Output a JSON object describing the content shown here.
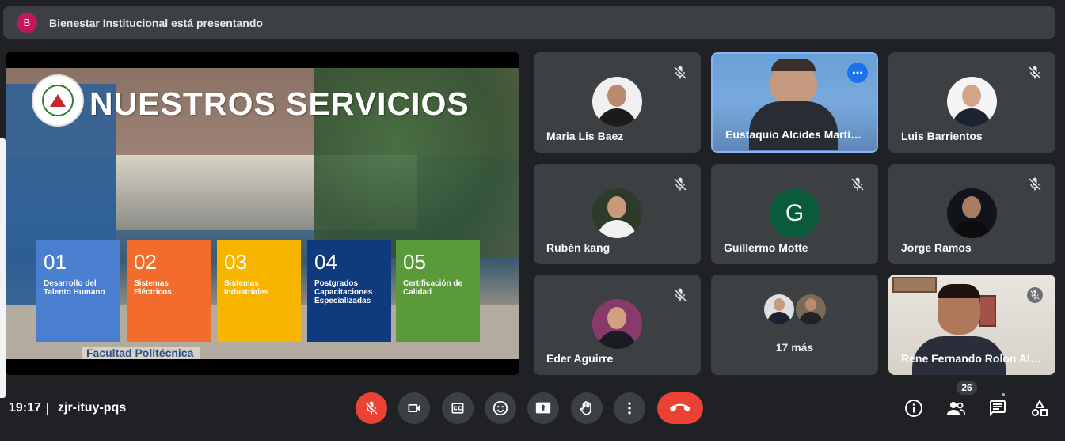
{
  "presenter_bar": {
    "avatar_letter": "B",
    "text": "Bienestar Institucional está presentando"
  },
  "slide": {
    "title": "NUESTROS SERVICIOS",
    "footer_sign": "Facultad Politécnica",
    "services": [
      {
        "num": "01",
        "label": "Desarrollo del Talento Humano",
        "color": "#4a7fd0"
      },
      {
        "num": "02",
        "label": "Sistemas Eléctricos",
        "color": "#f26d2d"
      },
      {
        "num": "03",
        "label": "Sistemas Industriales",
        "color": "#f7b500"
      },
      {
        "num": "04",
        "label": "Postgrados Capacitaciones Especializadas",
        "color": "#0f3a7d"
      },
      {
        "num": "05",
        "label": "Certificación de Calidad",
        "color": "#5a9a3a"
      }
    ]
  },
  "participants": [
    {
      "name": "Maria Lis Baez",
      "muted": true
    },
    {
      "name": "Eustaquio Alcides Martí…",
      "muted": false,
      "active": true
    },
    {
      "name": "Luis Barrientos",
      "muted": true
    },
    {
      "name": "Rubén kang",
      "muted": true
    },
    {
      "name": "Guillermo Motte",
      "muted": true,
      "letter": "G"
    },
    {
      "name": "Jorge Ramos",
      "muted": true
    },
    {
      "name": "Eder Aguirre",
      "muted": true
    },
    {
      "name": "17 más"
    },
    {
      "name": "Rene Fernando Rolon Al…",
      "muted": true
    }
  ],
  "bottom_bar": {
    "time": "19:17",
    "meeting_code": "zjr-ituy-pqs",
    "participant_count": "26"
  },
  "icons": {
    "mic": "mic-off-icon",
    "camera": "camera-icon",
    "captions": "captions-icon",
    "emoji": "emoji-icon",
    "present": "present-screen-icon",
    "hand": "raise-hand-icon",
    "more": "more-options-icon",
    "end": "end-call-icon",
    "info": "info-icon",
    "people": "people-icon",
    "chat": "chat-icon",
    "activities": "activities-icon"
  },
  "colors": {
    "background": "#202124",
    "tile": "#3c4043",
    "red": "#ea4335",
    "accent": "#8ab4f8"
  }
}
